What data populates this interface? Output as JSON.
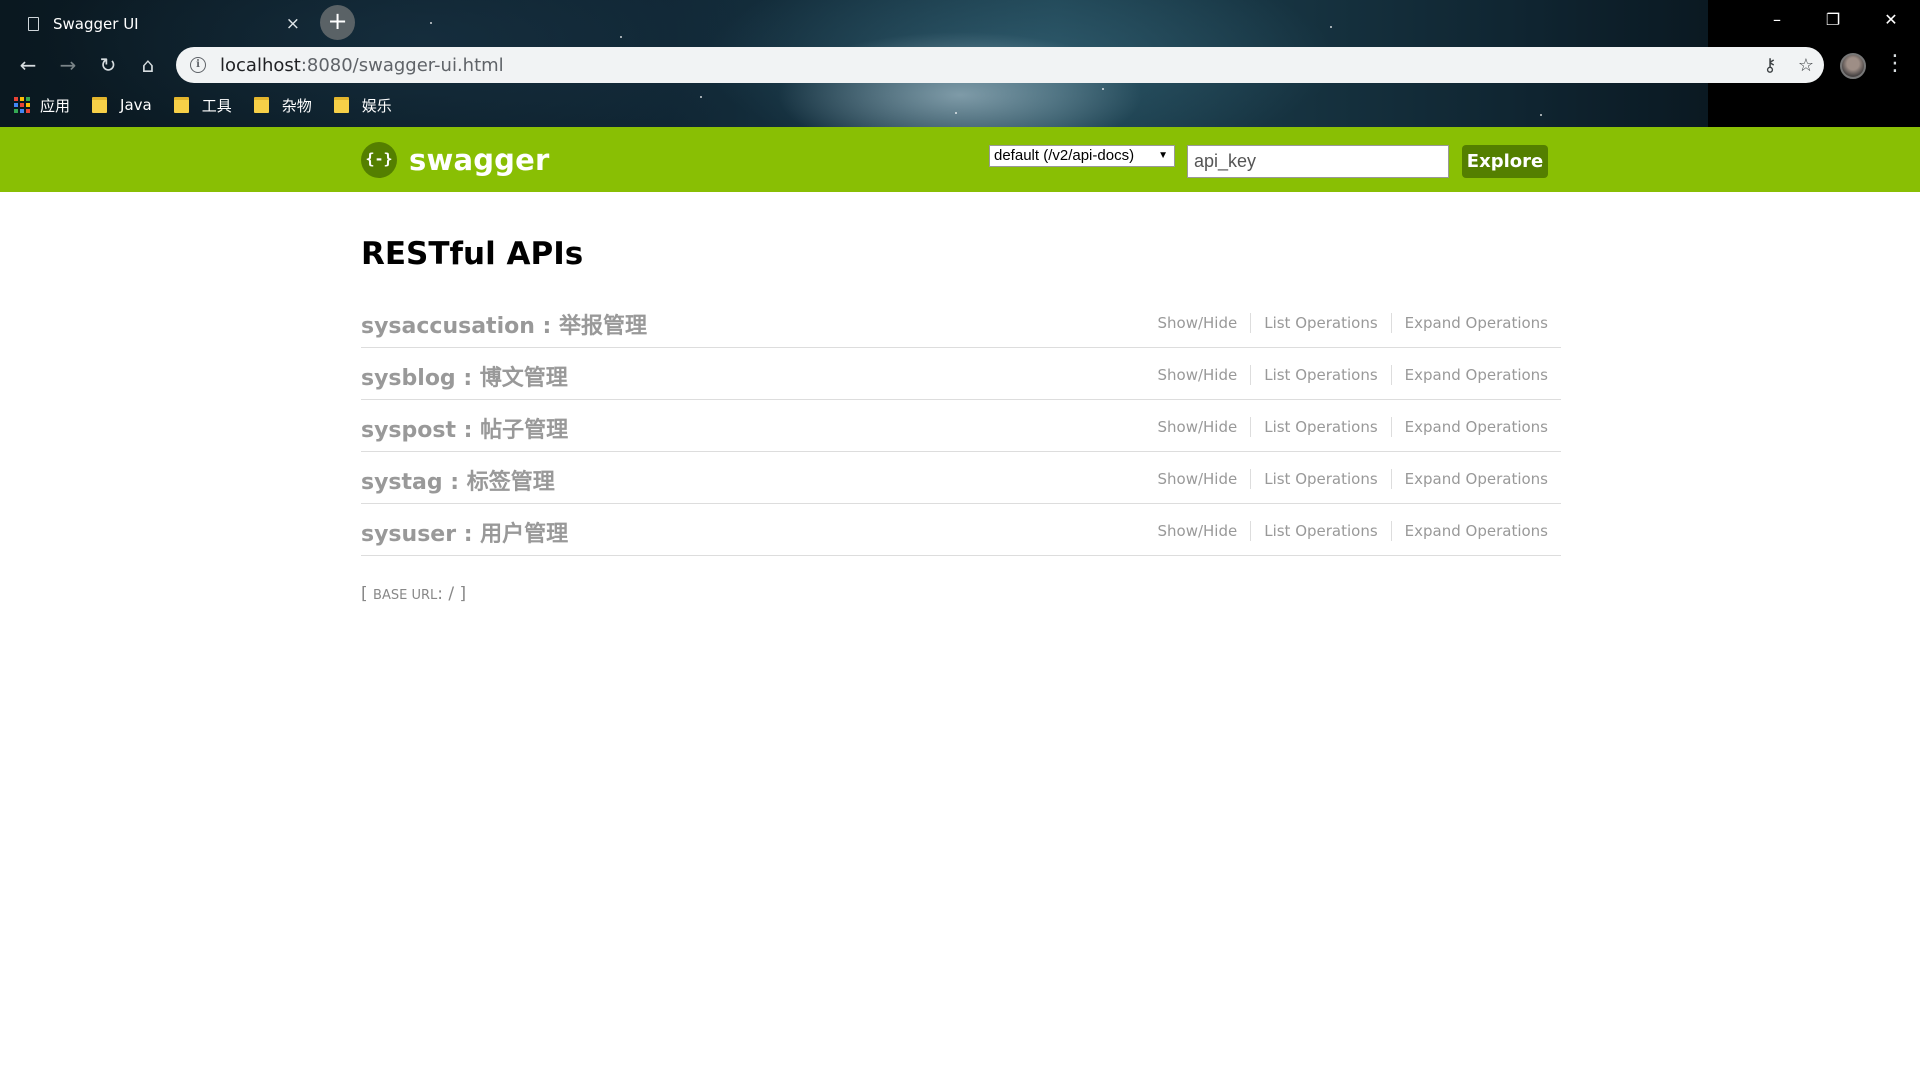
{
  "browser": {
    "tab_title": "Swagger UI",
    "tab_close": "×",
    "new_tab": "+",
    "url_host": "localhost",
    "url_rest": ":8080/swagger-ui.html",
    "window_controls": {
      "minimize": "–",
      "restore": "❐",
      "close": "✕"
    },
    "nav": {
      "back": "←",
      "forward": "→",
      "reload": "↻",
      "home": "⌂"
    },
    "omnibox_icons": {
      "key": "⚷",
      "star": "☆"
    },
    "menu": "⋮",
    "bookmarks": [
      {
        "label": "应用",
        "icon": "apps-grid-icon"
      },
      {
        "label": "Java",
        "icon": "folder-icon"
      },
      {
        "label": "工具",
        "icon": "folder-icon"
      },
      {
        "label": "杂物",
        "icon": "folder-icon"
      },
      {
        "label": "娱乐",
        "icon": "folder-icon"
      }
    ]
  },
  "header": {
    "logo_mark": "{-}",
    "logo_text": "swagger",
    "spec_select_value": "default (/v2/api-docs)",
    "api_key_placeholder": "api_key",
    "explore_label": "Explore",
    "brand_color": "#89bf04",
    "accent_color": "#547f00"
  },
  "main": {
    "title": "RESTful APIs",
    "resources": [
      {
        "name": "sysaccusation : 举报管理",
        "show_hide": "Show/Hide",
        "list": "List Operations",
        "expand": "Expand Operations"
      },
      {
        "name": "sysblog : 博文管理",
        "show_hide": "Show/Hide",
        "list": "List Operations",
        "expand": "Expand Operations"
      },
      {
        "name": "syspost : 帖子管理",
        "show_hide": "Show/Hide",
        "list": "List Operations",
        "expand": "Expand Operations"
      },
      {
        "name": "systag : 标签管理",
        "show_hide": "Show/Hide",
        "list": "List Operations",
        "expand": "Expand Operations"
      },
      {
        "name": "sysuser : 用户管理",
        "show_hide": "Show/Hide",
        "list": "List Operations",
        "expand": "Expand Operations"
      }
    ],
    "base_url_open": "[ ",
    "base_url_label": "BASE URL",
    "base_url_value": ": / ]"
  }
}
